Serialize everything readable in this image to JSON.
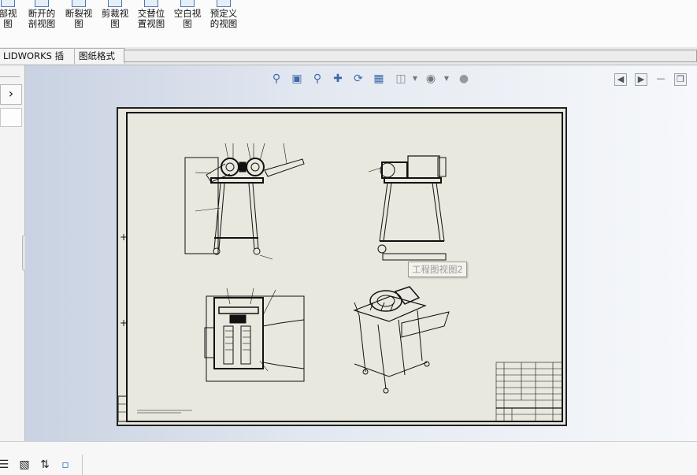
{
  "ribbon": {
    "buttons": [
      {
        "label": "部视\n图"
      },
      {
        "label": "断开的\n剖视图"
      },
      {
        "label": "断裂视\n图"
      },
      {
        "label": "剪裁视\n图"
      },
      {
        "label": "交替位\n置视图"
      },
      {
        "label": "空白视\n图"
      },
      {
        "label": "预定义\n的视图"
      }
    ]
  },
  "tabs": [
    {
      "label": "LIDWORKS 插件"
    },
    {
      "label": "图纸格式"
    }
  ],
  "left_panel": {
    "expand_glyph": "›"
  },
  "heads_up_toolbar": {
    "icons": [
      "zoom-to-fit-icon",
      "zoom-to-area-icon",
      "zoom-in-out-icon",
      "pan-icon",
      "rotate-icon",
      "view-orientation-icon",
      "display-style-icon",
      "hide-show-icon",
      "appearance-icon"
    ]
  },
  "window_controls": {
    "icons": [
      "prev-sheet-icon",
      "next-sheet-icon",
      "minimize-icon",
      "restore-icon"
    ]
  },
  "drawing": {
    "tooltip": "工程图视图2",
    "colors": {
      "sheet_fill": "#e9e8de",
      "line": "#111111",
      "canvas_left": "#c9d2e2",
      "canvas_right": "#f6f8fb"
    }
  },
  "bottom_bar": {
    "icons": [
      "list-view-icon",
      "detail-view-icon",
      "sort-icon",
      "chart-icon"
    ]
  }
}
